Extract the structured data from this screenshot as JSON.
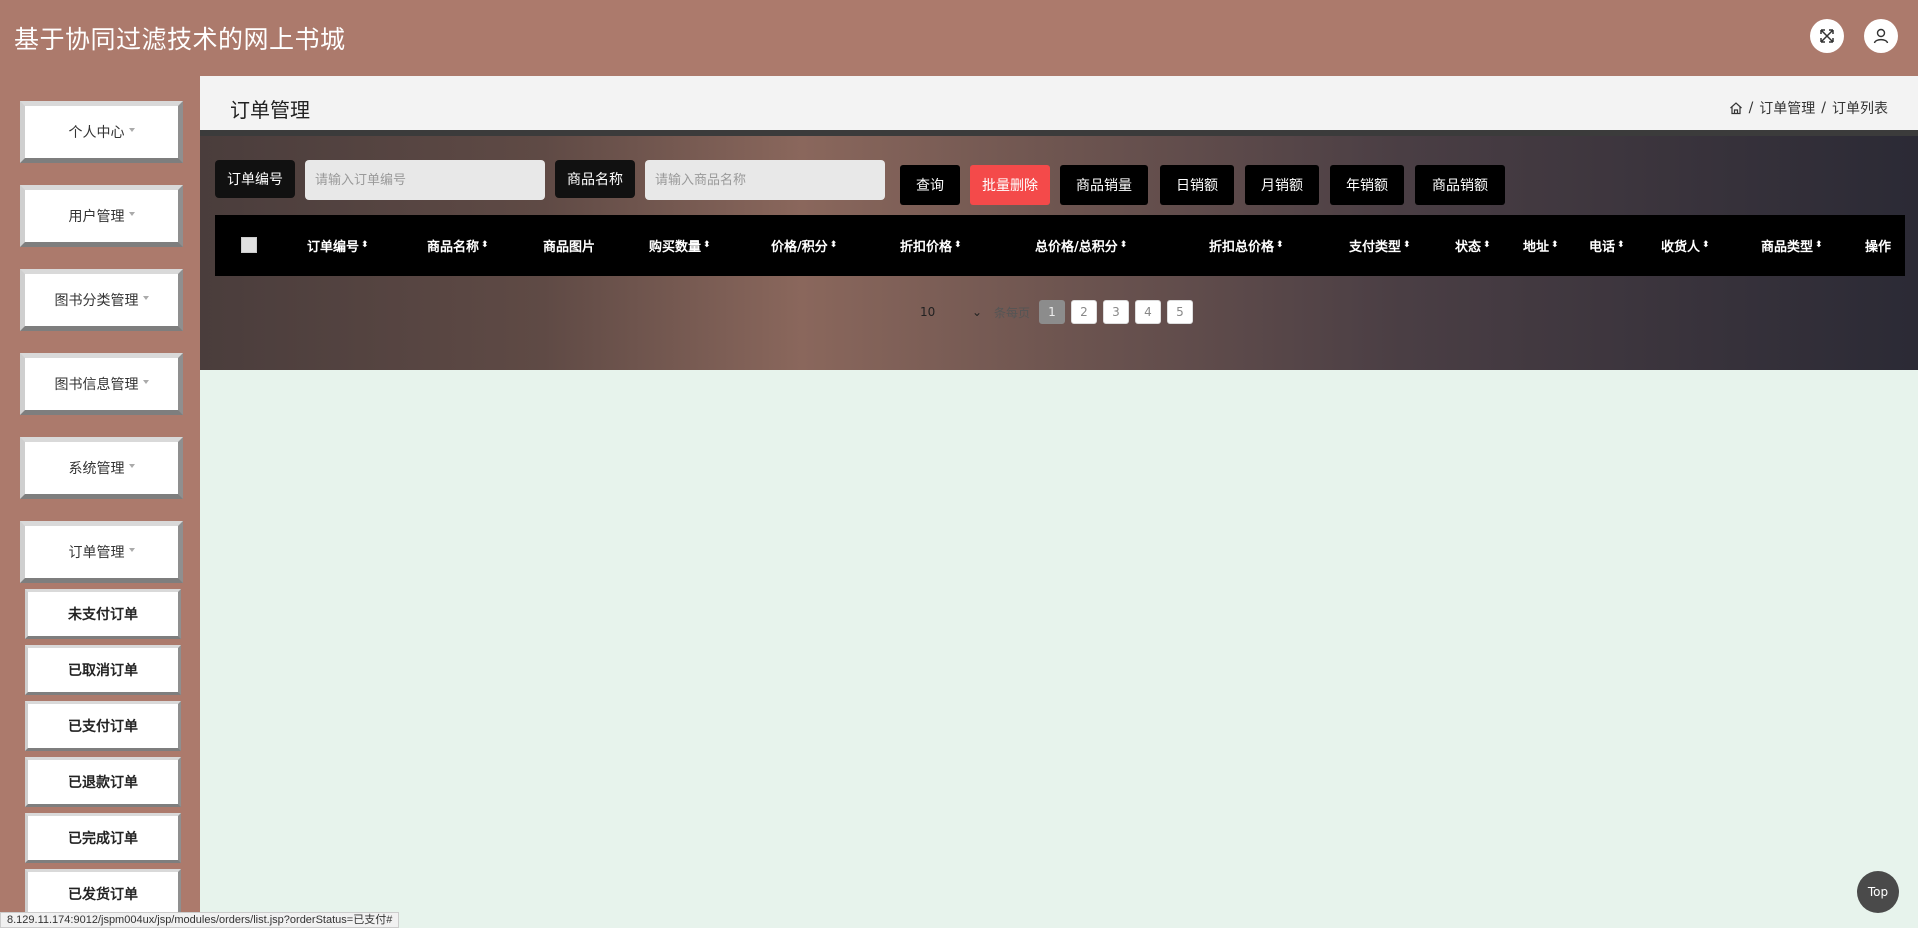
{
  "header": {
    "app_title": "基于协同过滤技术的网上书城",
    "icons": [
      "fullscreen-icon",
      "user-icon"
    ]
  },
  "sidebar": {
    "menus": [
      {
        "label": "个人中心"
      },
      {
        "label": "用户管理"
      },
      {
        "label": "图书分类管理"
      },
      {
        "label": "图书信息管理"
      },
      {
        "label": "系统管理"
      },
      {
        "label": "订单管理"
      }
    ],
    "submenus": [
      {
        "label": "未支付订单"
      },
      {
        "label": "已取消订单"
      },
      {
        "label": "已支付订单"
      },
      {
        "label": "已退款订单"
      },
      {
        "label": "已完成订单"
      },
      {
        "label": "已发货订单"
      }
    ]
  },
  "page": {
    "title": "订单管理",
    "breadcrumb": [
      "订单管理",
      "订单列表"
    ]
  },
  "search": {
    "order_no_label": "订单编号",
    "order_no_placeholder": "请输入订单编号",
    "product_label": "商品名称",
    "product_placeholder": "请输入商品名称"
  },
  "actions": {
    "query": "查询",
    "batch_delete": "批量删除",
    "product_sales_volume": "商品销量",
    "daily_sales": "日销额",
    "monthly_sales": "月销额",
    "yearly_sales": "年销额",
    "product_sales_amount": "商品销额"
  },
  "table": {
    "columns": [
      {
        "label": "订单编号",
        "sortable": true
      },
      {
        "label": "商品名称",
        "sortable": true
      },
      {
        "label": "商品图片",
        "sortable": false
      },
      {
        "label": "购买数量",
        "sortable": true
      },
      {
        "label": "价格/积分",
        "sortable": true
      },
      {
        "label": "折扣价格",
        "sortable": true
      },
      {
        "label": "总价格/总积分",
        "sortable": true
      },
      {
        "label": "折扣总价格",
        "sortable": true
      },
      {
        "label": "支付类型",
        "sortable": true
      },
      {
        "label": "状态",
        "sortable": true
      },
      {
        "label": "地址",
        "sortable": true
      },
      {
        "label": "电话",
        "sortable": true
      },
      {
        "label": "收货人",
        "sortable": true
      },
      {
        "label": "商品类型",
        "sortable": true
      },
      {
        "label": "操作",
        "sortable": false
      }
    ]
  },
  "pagination": {
    "page_size": "10",
    "per_page_label": "条每页",
    "pages": [
      "1",
      "2",
      "3",
      "4",
      "5"
    ],
    "current": "1"
  },
  "misc": {
    "top_button": "Top",
    "status_url": "8.129.11.174:9012/jspm004ux/jsp/modules/orders/list.jsp?orderStatus=已支付#"
  }
}
